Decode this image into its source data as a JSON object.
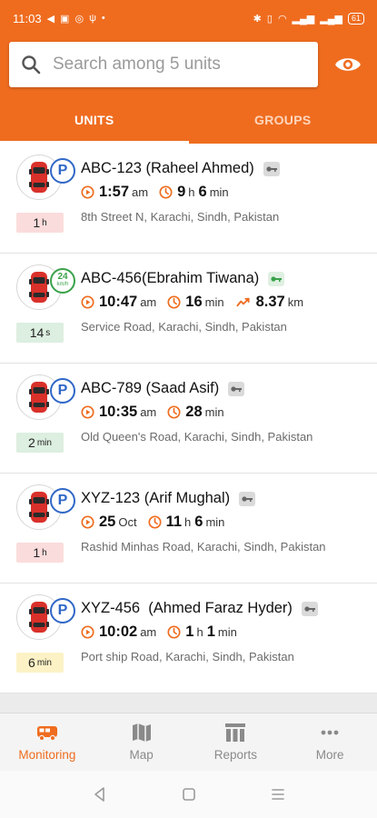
{
  "status_bar": {
    "time": "11:03",
    "battery": "61"
  },
  "search": {
    "placeholder": "Search among 5 units",
    "value": ""
  },
  "tabs": [
    {
      "label": "UNITS",
      "active": true
    },
    {
      "label": "GROUPS",
      "active": false
    }
  ],
  "colors": {
    "brand": "#ef6c1f",
    "parked_badge": "#2f67c7",
    "moving_badge": "#39a24a",
    "address": "#6b6b6b"
  },
  "units": [
    {
      "name": "ABC-123 (Raheel Ahmed)",
      "status_badge": "P",
      "ignition_icon": "key-grey",
      "time_value": "1:57",
      "time_unit": "am",
      "duration_hours": "9",
      "duration_h_unit": "h",
      "duration_minutes": "6",
      "duration_m_unit": "min",
      "address": "8th Street N, Karachi, Sindh, Pakistan",
      "state_duration": "1",
      "state_duration_unit": "h",
      "state_color": "red"
    },
    {
      "name": "ABC-456(Ebrahim Tiwana)",
      "status_badge": "speed",
      "speed_value": "24",
      "speed_unit": "km/h",
      "ignition_icon": "key-green",
      "time_value": "10:47",
      "time_unit": "am",
      "duration_minutes": "16",
      "duration_m_unit": "min",
      "distance_value": "8.37",
      "distance_unit": "km",
      "address": "Service Road, Karachi, Sindh, Pakistan",
      "state_duration": "14",
      "state_duration_unit": "s",
      "state_color": "green"
    },
    {
      "name": "ABC-789 (Saad Asif)",
      "status_badge": "P",
      "ignition_icon": "key-grey",
      "time_value": "10:35",
      "time_unit": "am",
      "duration_minutes": "28",
      "duration_m_unit": "min",
      "address": "Old Queen's Road, Karachi, Sindh, Pakistan",
      "state_duration": "2",
      "state_duration_unit": "min",
      "state_color": "green"
    },
    {
      "name": "XYZ-123 (Arif Mughal)",
      "status_badge": "P",
      "ignition_icon": "key-grey",
      "time_value": "25",
      "time_unit": "Oct",
      "duration_hours": "11",
      "duration_h_unit": "h",
      "duration_minutes": "6",
      "duration_m_unit": "min",
      "address": "Rashid Minhas Road, Karachi, Sindh, Pakistan",
      "state_duration": "1",
      "state_duration_unit": "h",
      "state_color": "red"
    },
    {
      "name": "XYZ-456  (Ahmed Faraz Hyder)",
      "status_badge": "P",
      "ignition_icon": "key-grey",
      "time_value": "10:02",
      "time_unit": "am",
      "duration_hours": "1",
      "duration_h_unit": "h",
      "duration_minutes": "1",
      "duration_m_unit": "min",
      "address": "Port ship Road, Karachi, Sindh, Pakistan",
      "state_duration": "6",
      "state_duration_unit": "min",
      "state_color": "yellow"
    }
  ],
  "bottom_nav": [
    {
      "label": "Monitoring",
      "icon": "truck-icon",
      "active": true
    },
    {
      "label": "Map",
      "icon": "map-icon",
      "active": false
    },
    {
      "label": "Reports",
      "icon": "reports-icon",
      "active": false
    },
    {
      "label": "More",
      "icon": "more-icon",
      "active": false
    }
  ]
}
